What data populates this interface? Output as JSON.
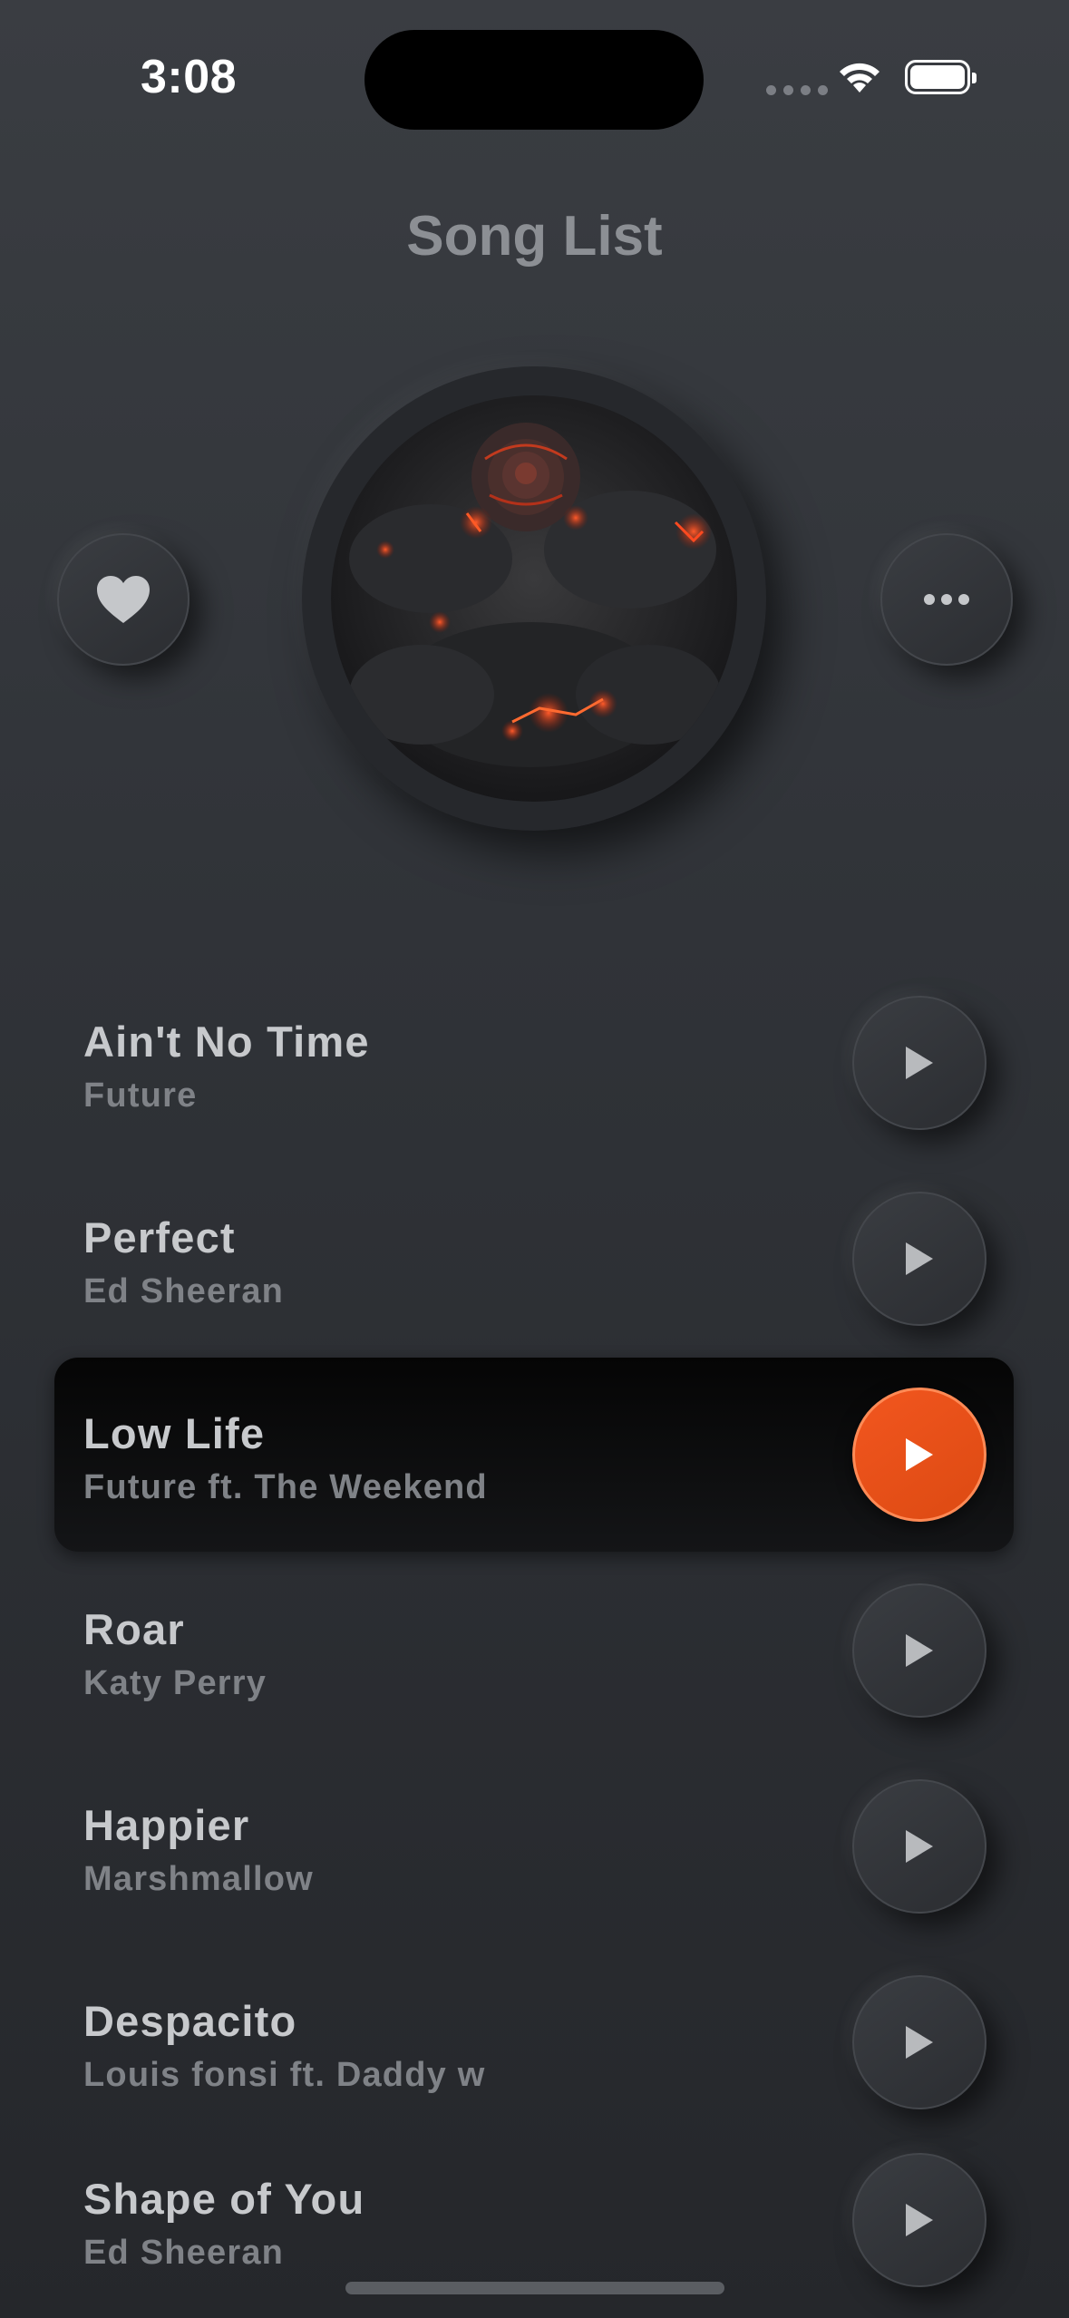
{
  "status_bar": {
    "time": "3:08"
  },
  "header": {
    "title": "Song List"
  },
  "icons": {
    "favorite": "heart-icon",
    "more": "more-horizontal-icon",
    "play": "play-icon"
  },
  "colors": {
    "accent": "#e8521a",
    "background": "#303338",
    "active_row": "#0a0a0b"
  },
  "songs": [
    {
      "title": "Ain't No Time",
      "artist": "Future",
      "active": false
    },
    {
      "title": "Perfect",
      "artist": "Ed Sheeran",
      "active": false
    },
    {
      "title": "Low Life",
      "artist": "Future ft. The Weekend",
      "active": true
    },
    {
      "title": "Roar",
      "artist": "Katy Perry",
      "active": false
    },
    {
      "title": "Happier",
      "artist": "Marshmallow",
      "active": false
    },
    {
      "title": "Despacito",
      "artist": "Louis fonsi ft. Daddy w",
      "active": false
    },
    {
      "title": "Shape of You",
      "artist": "Ed Sheeran",
      "active": false
    }
  ]
}
